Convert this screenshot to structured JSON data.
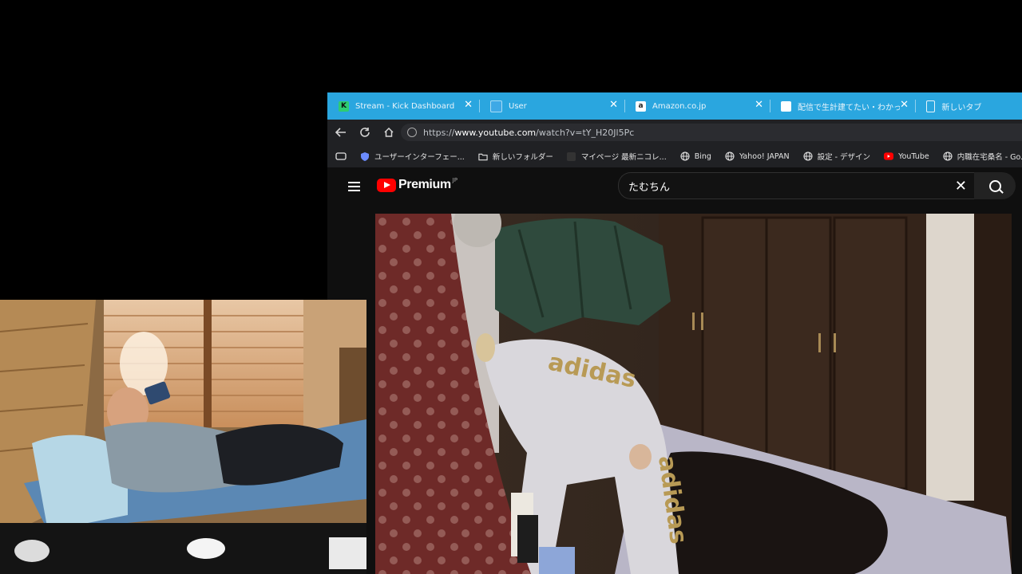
{
  "tabs": [
    {
      "label": "Stream - Kick Dashboard",
      "favicon": "K",
      "favicon_color": "#2ecc71"
    },
    {
      "label": "User",
      "favicon": "",
      "favicon_color": "#1a73e8"
    },
    {
      "label": "Amazon.co.jp",
      "favicon": "a",
      "favicon_color": "#ffffff"
    },
    {
      "label": "配信で生計建てたい・わかってんけど…",
      "favicon": "",
      "favicon_color": "#ffffff"
    },
    {
      "label": "新しいタブ",
      "favicon": "",
      "favicon_color": "#ffffff"
    }
  ],
  "address": {
    "scheme": "https://",
    "host": "www.youtube.com",
    "path": "/watch?v=tY_H20Jl5Pc"
  },
  "bookmarks": [
    {
      "label": "ユーザーインターフェー...",
      "icon": "shield-icon"
    },
    {
      "label": "新しいフォルダー",
      "icon": "folder-icon"
    },
    {
      "label": "マイページ 最新ニコレ...",
      "icon": "page-icon"
    },
    {
      "label": "Bing",
      "icon": "globe-icon"
    },
    {
      "label": "Yahoo! JAPAN",
      "icon": "globe-icon"
    },
    {
      "label": "設定 - デザイン",
      "icon": "globe-icon"
    },
    {
      "label": "YouTube",
      "icon": "youtube-icon"
    },
    {
      "label": "内職在宅桑名 - Go...",
      "icon": "globe-icon"
    }
  ],
  "youtube": {
    "logo_text": "Premium",
    "country_code": "JP",
    "search_query": "たむちん"
  },
  "colors": {
    "tabbar": "#2aa6df",
    "youtube_red": "#ff0000",
    "background": "#0f0f0f"
  }
}
